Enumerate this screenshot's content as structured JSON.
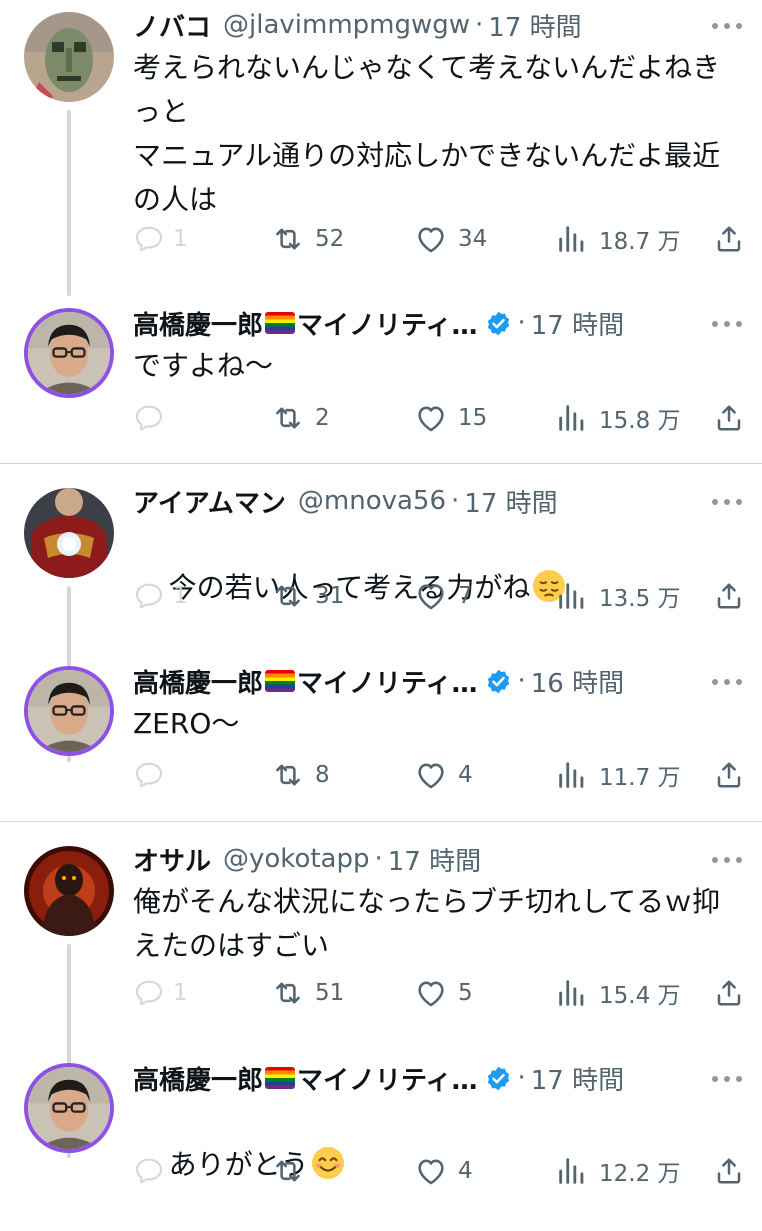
{
  "threads": [
    {
      "reply": {
        "name": "ノバコ",
        "handle": "@jlavimmpmgwgw",
        "dot": "·",
        "time": "17 時間",
        "text": "考えられないんじゃなくて考えないんだよねきっと\nマニュアル通りの対応しかできないんだよ最近の人は",
        "stats": {
          "replies": "1",
          "retweets": "52",
          "likes": "34",
          "views": "18.7 万"
        }
      },
      "answer": {
        "name": "高橋慶一郎",
        "name_suffix": "マイノリティ…",
        "dot": "·",
        "time": "17 時間",
        "text": "ですよね〜",
        "stats": {
          "replies": "",
          "retweets": "2",
          "likes": "15",
          "views": "15.8 万"
        }
      }
    },
    {
      "reply": {
        "name": "アイアムマン",
        "handle": "@mnova56",
        "dot": "·",
        "time": "17 時間",
        "text": "今の若い人って考える力がね",
        "emoji": "pensive-face",
        "stats": {
          "replies": "1",
          "retweets": "31",
          "likes": "7",
          "views": "13.5 万"
        }
      },
      "answer": {
        "name": "高橋慶一郎",
        "name_suffix": "マイノリティ…",
        "dot": "·",
        "time": "16 時間",
        "text": "ZERO〜",
        "stats": {
          "replies": "",
          "retweets": "8",
          "likes": "4",
          "views": "11.7 万"
        }
      }
    },
    {
      "reply": {
        "name": "オサル",
        "handle": "@yokotapp",
        "dot": "·",
        "time": "17 時間",
        "text": "俺がそんな状況になったらブチ切れしてるｗ抑えたのはすごい",
        "stats": {
          "replies": "1",
          "retweets": "51",
          "likes": "5",
          "views": "15.4 万"
        }
      },
      "answer": {
        "name": "高橋慶一郎",
        "name_suffix": "マイノリティ…",
        "dot": "·",
        "time": "17 時間",
        "text": "ありがとう",
        "emoji": "smiling-face",
        "stats": {
          "replies": "",
          "retweets": "",
          "likes": "4",
          "views": "12.2 万"
        }
      }
    }
  ],
  "icons": {
    "reply": "speech-bubble-icon",
    "retweet": "retweet-arrows-icon",
    "like": "heart-outline-icon",
    "views": "bar-chart-icon",
    "share": "share-upload-icon",
    "more": "three-dots-icon",
    "verified": "blue-check-badge-icon",
    "pride": "rainbow-flag-emoji"
  },
  "colors": {
    "text": "#0f1419",
    "muted": "#536471",
    "verified": "#1d9bf0",
    "avatar_ring": "#8e52e3",
    "divider": "#cfd9de"
  }
}
